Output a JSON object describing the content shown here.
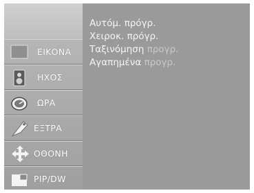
{
  "menu": {
    "items": [
      {
        "label": "ΕΙΚΟΝΑ",
        "icon": "picture-icon"
      },
      {
        "label": "ΗΧΟΣ",
        "icon": "speaker-icon"
      },
      {
        "label": "ΩΡΑ",
        "icon": "clock-icon"
      },
      {
        "label": "ΕΞΤΡΑ",
        "icon": "tag-icon"
      },
      {
        "label": "ΟΘΟΝΗ",
        "icon": "move-arrows-icon"
      },
      {
        "label": "PIP/DW",
        "icon": "pip-icon"
      }
    ]
  },
  "submenu": {
    "items": [
      {
        "label": "Αυτόμ. πρόγρ."
      },
      {
        "label": "Χειροκ. πρόγρ."
      },
      {
        "label": "Ταξινόμηση ",
        "suffix": "προγρ."
      },
      {
        "label": "Αγαπημένα ",
        "suffix": "προγρ."
      }
    ]
  }
}
